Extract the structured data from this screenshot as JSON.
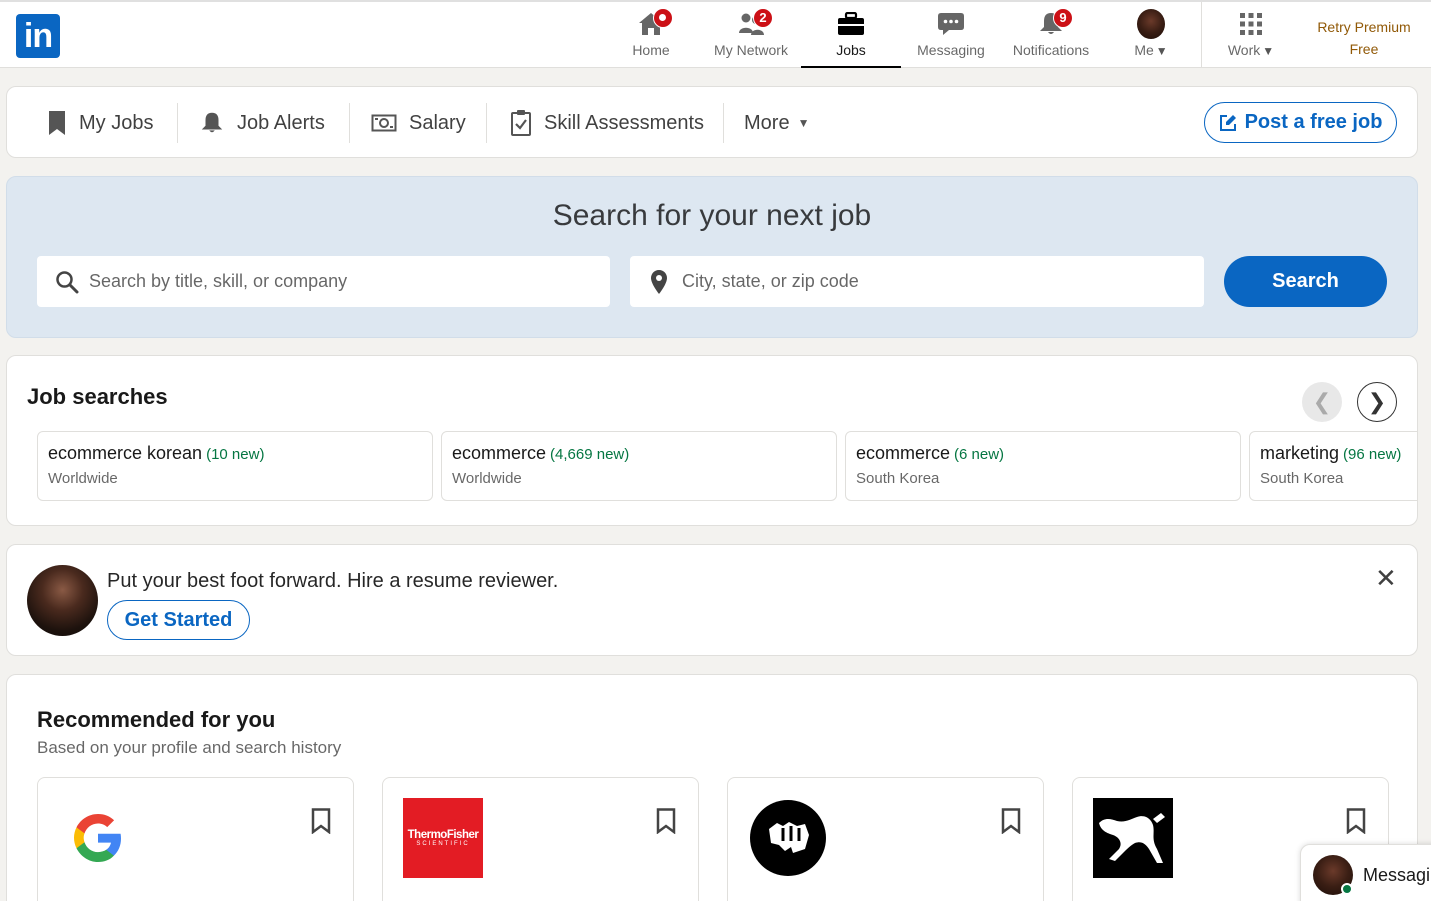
{
  "brand": {
    "logo_text": "in",
    "accent": "#0a66c2"
  },
  "nav": {
    "items": [
      {
        "label": "Home",
        "icon": "home-icon",
        "badge": ""
      },
      {
        "label": "My Network",
        "icon": "network-icon",
        "badge": "2"
      },
      {
        "label": "Jobs",
        "icon": "briefcase-icon",
        "badge": ""
      },
      {
        "label": "Messaging",
        "icon": "messaging-icon",
        "badge": ""
      },
      {
        "label": "Notifications",
        "icon": "bell-icon",
        "badge": "9"
      },
      {
        "label": "Me",
        "icon": "avatar",
        "badge": ""
      },
      {
        "label": "Work",
        "icon": "grid-icon",
        "badge": ""
      }
    ],
    "premium_line1": "Retry Premium",
    "premium_line2": "Free"
  },
  "subnav": {
    "my_jobs": "My Jobs",
    "job_alerts": "Job Alerts",
    "salary": "Salary",
    "skill_assessments": "Skill Assessments",
    "more": "More",
    "post_job": "Post a free job"
  },
  "search": {
    "title": "Search for your next job",
    "keyword_placeholder": "Search by title, skill, or company",
    "location_placeholder": "City, state, or zip code",
    "button": "Search"
  },
  "job_searches": {
    "title": "Job searches",
    "items": [
      {
        "query": "ecommerce korean",
        "new": "(10 new)",
        "location": "Worldwide"
      },
      {
        "query": "ecommerce",
        "new": "(4,669 new)",
        "location": "Worldwide"
      },
      {
        "query": "ecommerce",
        "new": "(6 new)",
        "location": "South Korea"
      },
      {
        "query": "marketing",
        "new": "(96 new)",
        "location": "South Korea"
      }
    ]
  },
  "promo": {
    "text": "Put your best foot forward. Hire a resume reviewer.",
    "button": "Get Started"
  },
  "recommended": {
    "title": "Recommended for you",
    "subtitle": "Based on your profile and search history",
    "companies": [
      {
        "name": "Google",
        "logo": "google-logo"
      },
      {
        "name": "ThermoFisher",
        "logo_line1": "ThermoFisher",
        "logo_line2": "SCIENTIFIC",
        "color": "#e31c24"
      },
      {
        "name": "Riot Games",
        "logo": "riot-fist-logo"
      },
      {
        "name": "Puma",
        "logo": "puma-logo"
      }
    ]
  },
  "messaging": {
    "label": "Messaging"
  }
}
